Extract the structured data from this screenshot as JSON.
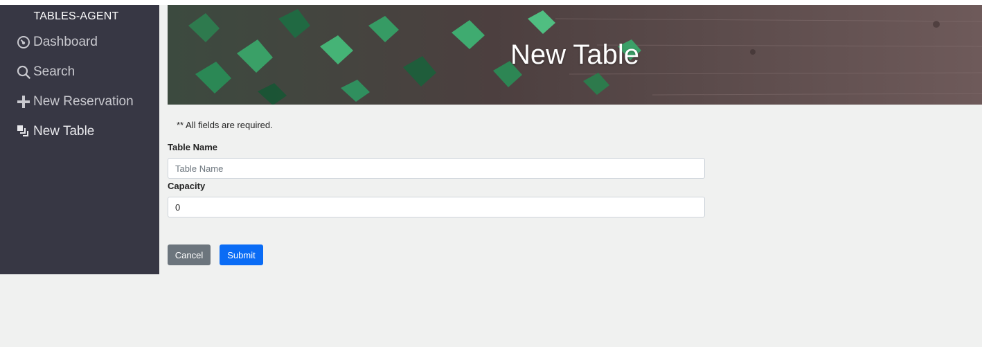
{
  "app": {
    "brand": "TABLES-AGENT"
  },
  "sidebar": {
    "items": [
      {
        "label": "Dashboard",
        "icon": "dashboard-gauge-icon"
      },
      {
        "label": "Search",
        "icon": "search-icon"
      },
      {
        "label": "New Reservation",
        "icon": "plus-icon"
      },
      {
        "label": "New Table",
        "icon": "table-stack-icon"
      }
    ]
  },
  "header": {
    "title": "New Table"
  },
  "form": {
    "required_note": "** All fields are required.",
    "table_name": {
      "label": "Table Name",
      "placeholder": "Table Name",
      "value": ""
    },
    "capacity": {
      "label": "Capacity",
      "value": "0"
    },
    "cancel_label": "Cancel",
    "submit_label": "Submit"
  },
  "colors": {
    "sidebar_bg": "#373744",
    "page_bg": "#f0f1f0",
    "cancel_bg": "#6c757d",
    "submit_bg": "#0a6cf5"
  }
}
